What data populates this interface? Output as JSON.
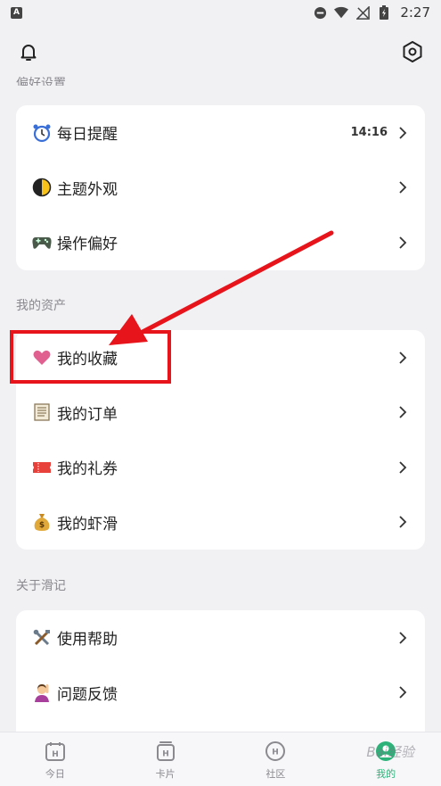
{
  "status_bar": {
    "time": "2:27",
    "app_badge": "A"
  },
  "top_bar": {
    "left_icon": "bell-icon",
    "right_icon": "settings-hex-icon"
  },
  "sections": {
    "prefs_title": "偏好设置",
    "assets_title": "我的资产",
    "about_title": "关于滑记"
  },
  "prefs": [
    {
      "icon": "alarm-clock-icon",
      "label": "每日提醒",
      "value": "14:16"
    },
    {
      "icon": "half-moon-icon",
      "label": "主题外观"
    },
    {
      "icon": "gamepad-icon",
      "label": "操作偏好"
    }
  ],
  "assets": [
    {
      "icon": "heart-icon",
      "label": "我的收藏"
    },
    {
      "icon": "receipt-icon",
      "label": "我的订单"
    },
    {
      "icon": "ticket-icon",
      "label": "我的礼券"
    },
    {
      "icon": "money-bag-icon",
      "label": "我的虾滑"
    }
  ],
  "about": [
    {
      "icon": "tools-icon",
      "label": "使用帮助"
    },
    {
      "icon": "person-raising-hand-icon",
      "label": "问题反馈"
    }
  ],
  "nav": [
    {
      "icon": "calendar-icon",
      "label": "今日"
    },
    {
      "icon": "cards-icon",
      "label": "卡片"
    },
    {
      "icon": "community-icon",
      "label": "社区"
    },
    {
      "icon": "profile-icon",
      "label": "我的"
    }
  ],
  "watermark": "Bai经验",
  "colors": {
    "accent": "#2db37a",
    "annotation": "#e8141b",
    "background": "#f1f1f4"
  }
}
